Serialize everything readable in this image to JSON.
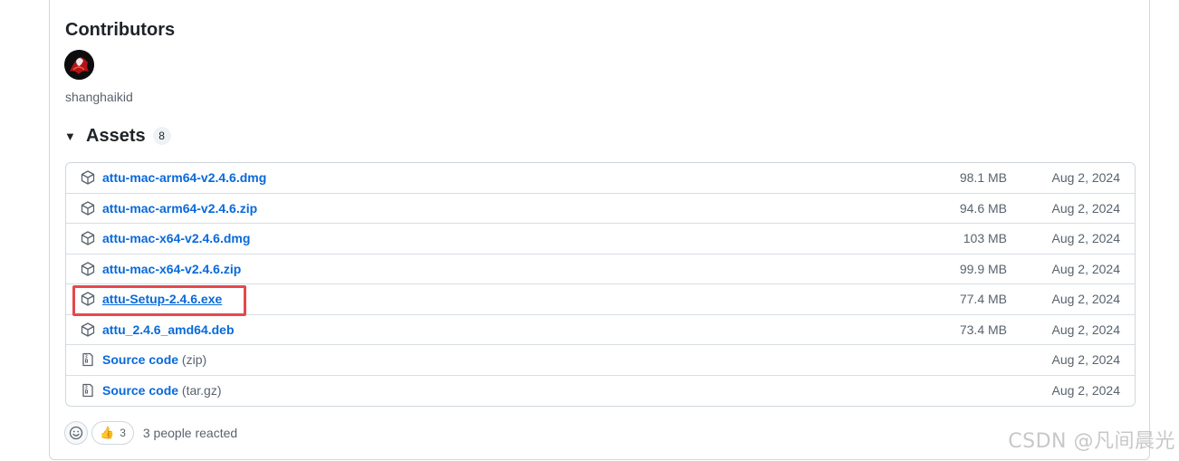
{
  "contributors": {
    "title": "Contributors",
    "users": [
      {
        "name": "shanghaikid"
      }
    ]
  },
  "assets": {
    "title": "Assets",
    "count": "8",
    "items": [
      {
        "name": "attu-mac-arm64-v2.4.6.dmg",
        "suffix": "",
        "size": "98.1 MB",
        "date": "Aug 2, 2024",
        "icon": "package-icon"
      },
      {
        "name": "attu-mac-arm64-v2.4.6.zip",
        "suffix": "",
        "size": "94.6 MB",
        "date": "Aug 2, 2024",
        "icon": "package-icon"
      },
      {
        "name": "attu-mac-x64-v2.4.6.dmg",
        "suffix": "",
        "size": "103 MB",
        "date": "Aug 2, 2024",
        "icon": "package-icon"
      },
      {
        "name": "attu-mac-x64-v2.4.6.zip",
        "suffix": "",
        "size": "99.9 MB",
        "date": "Aug 2, 2024",
        "icon": "package-icon"
      },
      {
        "name": "attu-Setup-2.4.6.exe",
        "suffix": "",
        "size": "77.4 MB",
        "date": "Aug 2, 2024",
        "icon": "package-icon"
      },
      {
        "name": "attu_2.4.6_amd64.deb",
        "suffix": "",
        "size": "73.4 MB",
        "date": "Aug 2, 2024",
        "icon": "package-icon"
      },
      {
        "name": "Source code",
        "suffix": "(zip)",
        "size": "",
        "date": "Aug 2, 2024",
        "icon": "file-zip-icon"
      },
      {
        "name": "Source code",
        "suffix": "(tar.gz)",
        "size": "",
        "date": "Aug 2, 2024",
        "icon": "file-zip-icon"
      }
    ]
  },
  "reactions": {
    "thumbs_up_count": "3",
    "summary": "3 people reacted"
  },
  "watermark": "CSDN @凡间晨光",
  "colors": {
    "link": "#0969da",
    "highlight": "#e5484d"
  }
}
